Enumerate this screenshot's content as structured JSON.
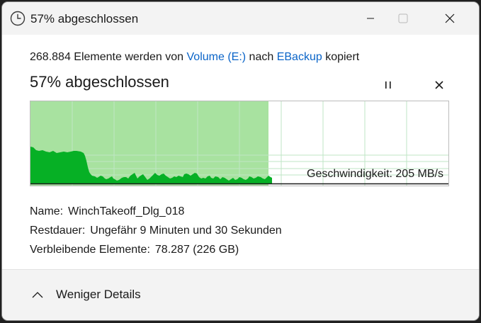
{
  "window": {
    "title": "57% abgeschlossen"
  },
  "header": {
    "copy_prefix": "268.884 Elemente werden von",
    "source": "Volume (E:)",
    "copy_middle": "nach",
    "destination": "EBackup",
    "copy_suffix": "kopiert",
    "progress_title": "57% abgeschlossen"
  },
  "progress": {
    "percent": 57,
    "speed_label": "Geschwindigkeit: 205 MB/s"
  },
  "details": {
    "name_label": "Name:",
    "name_value": "WinchTakeoff_Dlg_018",
    "remaining_time_label": "Restdauer:",
    "remaining_time_value": "Ungefähr 9 Minuten und 30 Sekunden",
    "remaining_items_label": "Verbleibende Elemente:",
    "remaining_items_value": "78.287 (226 GB)"
  },
  "footer": {
    "less_details_label": "Weniger Details"
  },
  "icons": {
    "title": "clock-icon",
    "minimize": "minimize-icon",
    "maximize": "maximize-icon",
    "close": "close-icon",
    "pause": "pause-icon",
    "cancel": "cancel-icon",
    "collapse": "chevron-up-icon"
  },
  "colors": {
    "progress_fill": "#a8e2a0",
    "throughput_area": "#06b025",
    "grid": "#bfe6c5",
    "link": "#0a64c8"
  }
}
